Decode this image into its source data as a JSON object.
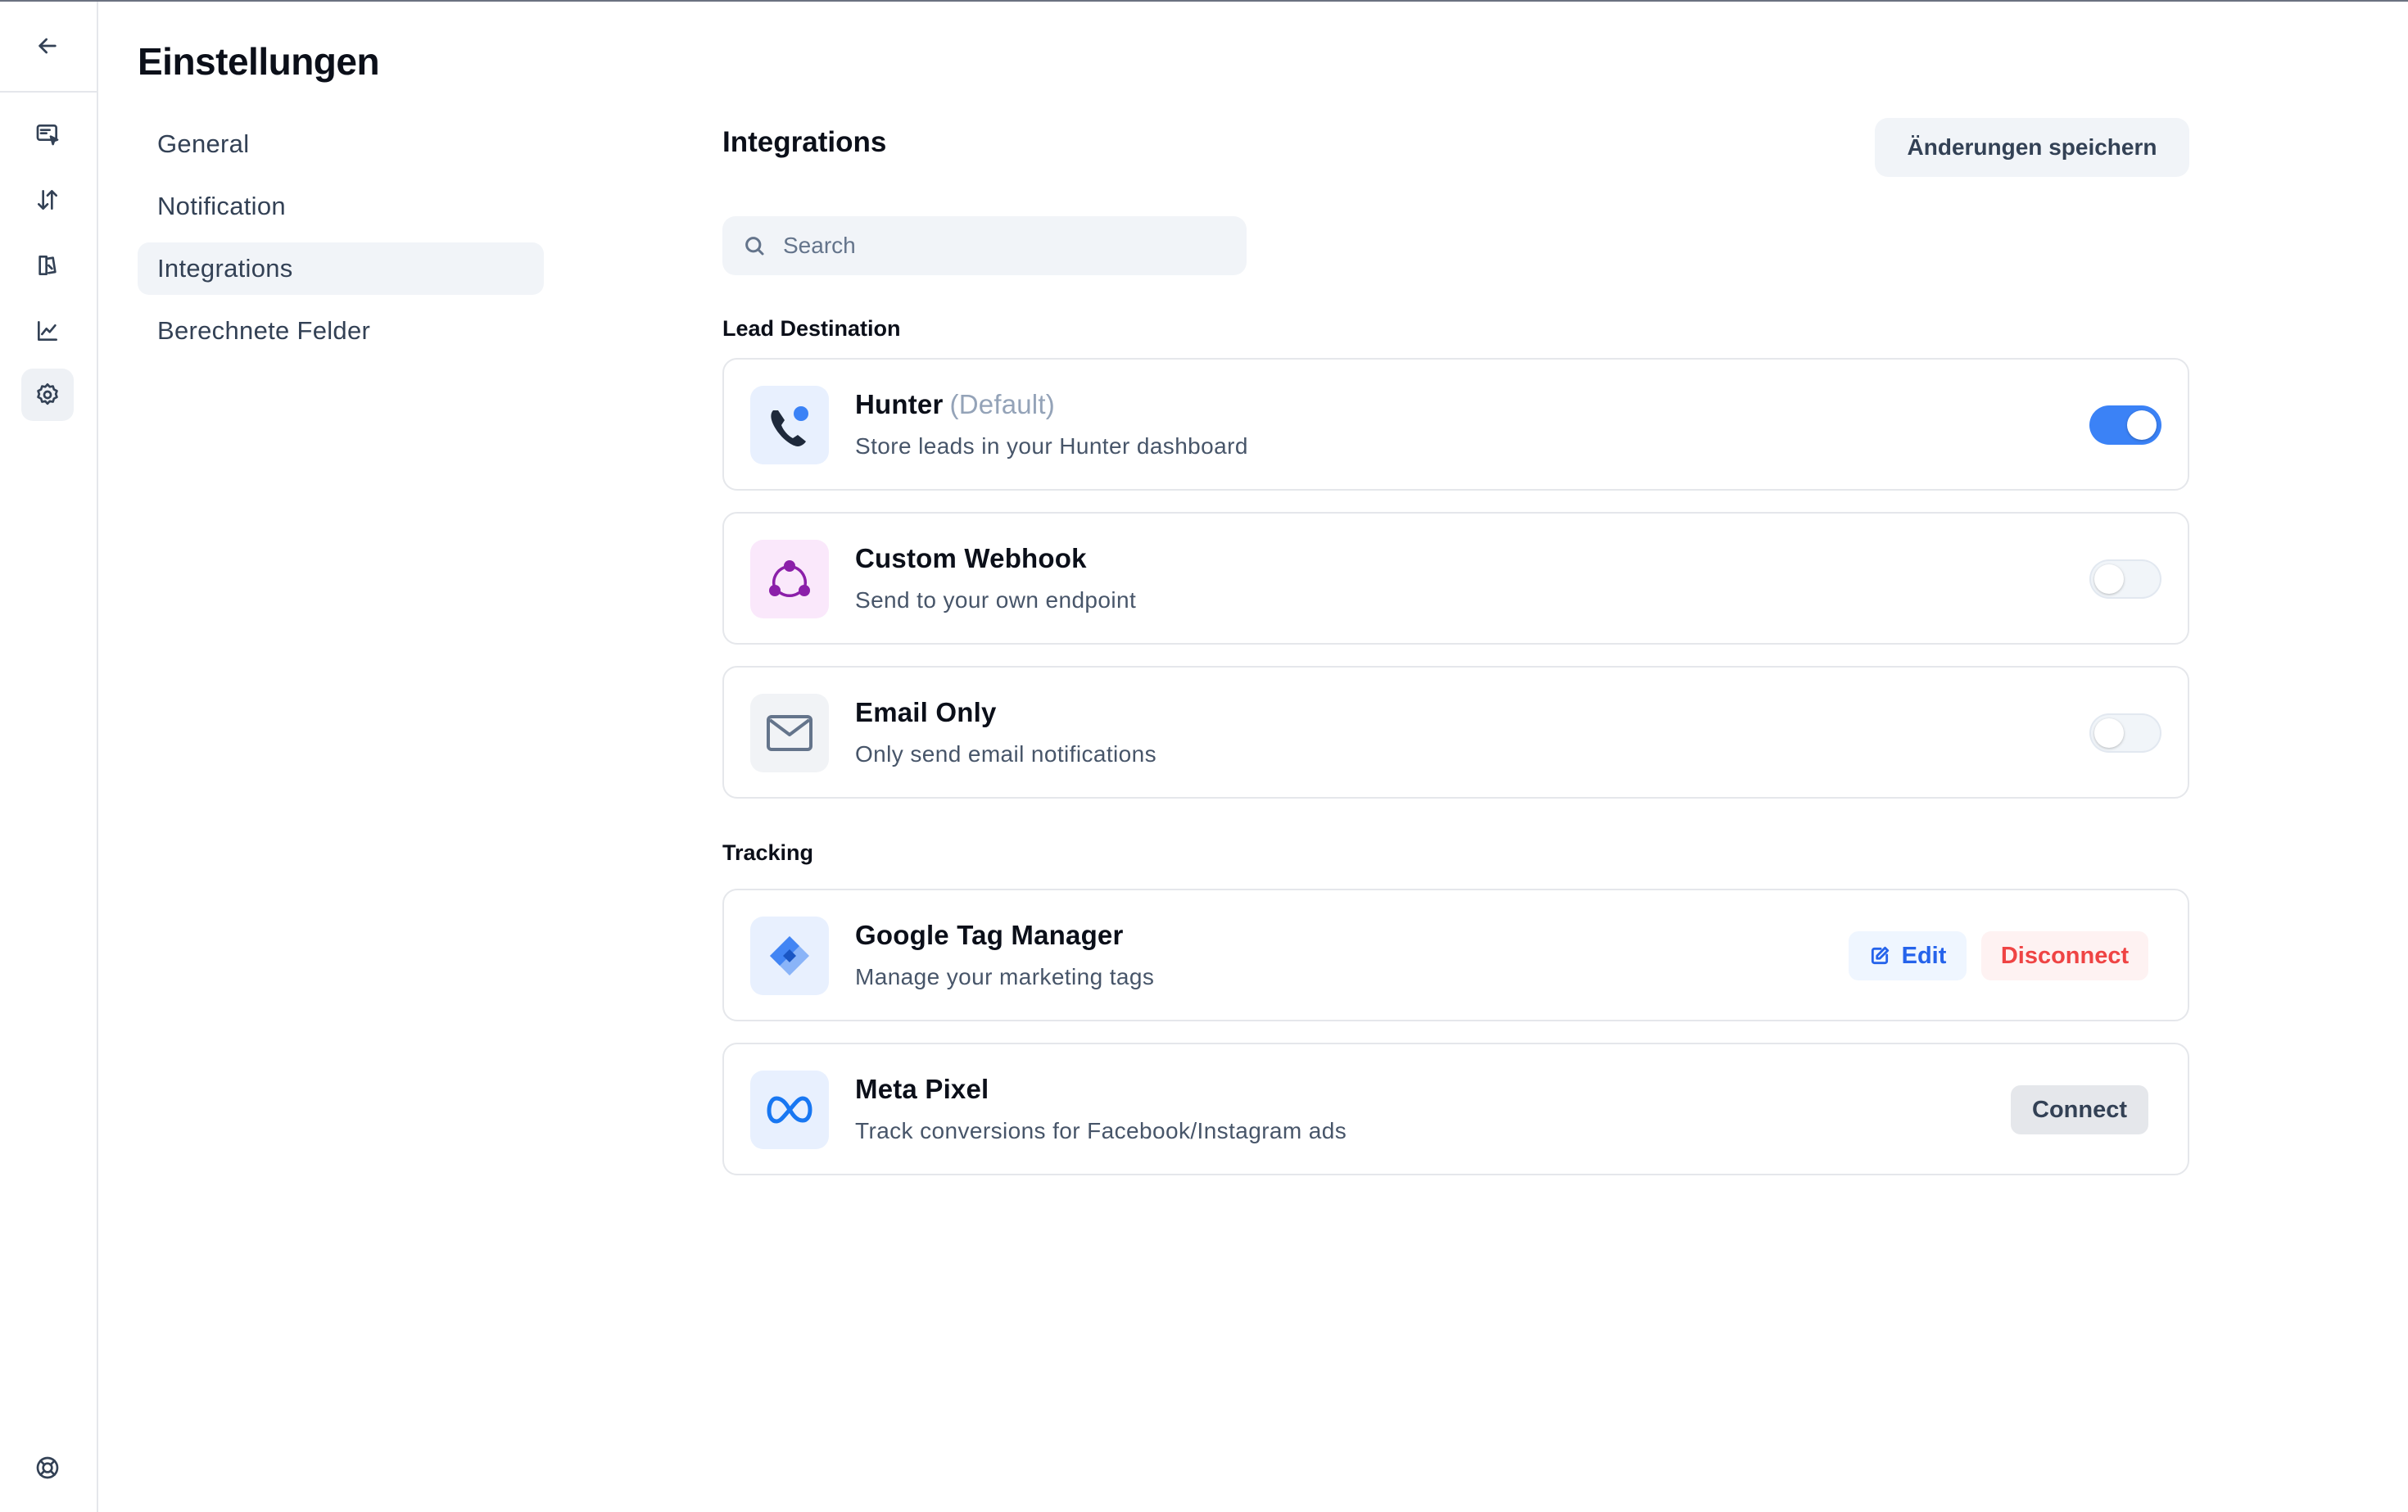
{
  "app": {
    "title": "Einstellungen"
  },
  "rail": {
    "icons": [
      "arrow-left-icon",
      "chat-pointer-icon",
      "sort-arrows-icon",
      "book-icon",
      "chart-icon",
      "gear-icon",
      "lifebuoy-icon"
    ],
    "active": "gear-icon"
  },
  "nav": {
    "items": [
      {
        "label": "General",
        "active": false
      },
      {
        "label": "Notification",
        "active": false
      },
      {
        "label": "Integrations",
        "active": true
      },
      {
        "label": "Berechnete Felder",
        "active": false
      }
    ]
  },
  "main": {
    "title": "Integrations",
    "save_label": "Änderungen speichern",
    "search_placeholder": "Search",
    "search_value": ""
  },
  "lead_destination": {
    "label": "Lead Destination",
    "items": [
      {
        "name": "Hunter",
        "tag": "(Default)",
        "description": "Store leads in your Hunter dashboard",
        "enabled": true,
        "icon": "phone-icon"
      },
      {
        "name": "Custom Webhook",
        "description": "Send to your own endpoint",
        "enabled": false,
        "icon": "webhook-icon"
      },
      {
        "name": "Email Only",
        "description": "Only send email notifications",
        "enabled": false,
        "icon": "envelope-icon"
      }
    ]
  },
  "tracking": {
    "label": "Tracking",
    "items": [
      {
        "name": "Google Tag Manager",
        "description": "Manage your marketing tags",
        "icon": "google-tag-manager-icon",
        "edit_label": "Edit",
        "disconnect_label": "Disconnect"
      },
      {
        "name": "Meta Pixel",
        "description": "Track conversions for Facebook/Instagram ads",
        "icon": "meta-icon",
        "connect_label": "Connect"
      }
    ]
  },
  "colors": {
    "accent": "#3b82f6",
    "danger": "#ef4444",
    "webhook": "#8b1fa9",
    "panel": "#f1f4f8"
  }
}
